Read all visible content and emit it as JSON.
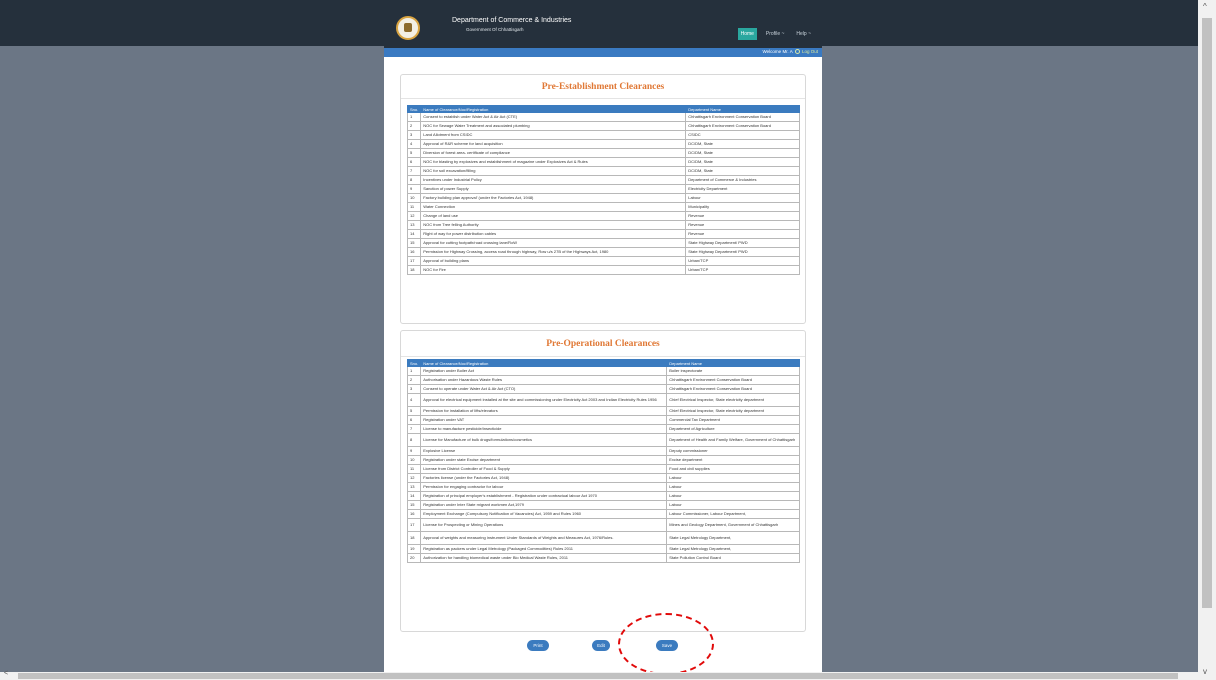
{
  "header": {
    "department": "Department of Commerce & Industries",
    "government": "Government Of Chhattisgarh",
    "nav": [
      {
        "label": "Home"
      },
      {
        "label": "Profile ~"
      },
      {
        "label": "Help ~"
      }
    ],
    "welcome": "Welcome Mr. A",
    "logout": "Log Out"
  },
  "colors": {
    "accent": "#e07835",
    "table_header": "#3b7bbf",
    "nav_active": "#2aa79f",
    "header_bg": "#25303c",
    "annotation": "#e10a0a"
  },
  "pre_establishment": {
    "title": "Pre-Establishment Clearances",
    "columns": [
      "Sno.",
      "Name of Clearance/Noc/Registration",
      "Department Name"
    ],
    "rows": [
      [
        "1",
        "Consent to establish under Water Act & Air Act (CTE)",
        "Chhattisgarh Environment Conservation Board"
      ],
      [
        "2",
        "NOC for Sewage Water Treatment and associated plumbing",
        "Chhattisgarh Environment Conservation Board"
      ],
      [
        "3",
        "Land Allotment from CSIDC",
        "CSIDC"
      ],
      [
        "4",
        "Approval of R&R scheme for land acquisition",
        "DC/DM, State"
      ],
      [
        "5",
        "Diversion of forest area- certificate of compliance",
        "DC/DM, State"
      ],
      [
        "6",
        "NOC for blasting by explosives and establishment of magazine under Explosives Act & Rules",
        "DC/DM, State"
      ],
      [
        "7",
        "NOC for soil excavation/filling",
        "DC/DM, State"
      ],
      [
        "8",
        "Incentives under Industrial Policy",
        "Department of Commerce & Industries"
      ],
      [
        "9",
        "Sanction of power Supply",
        "Electricity Department"
      ],
      [
        "10",
        "Factory building plan approval' (under the Factories Act, 1948)",
        "Labour"
      ],
      [
        "11",
        "Water Connection",
        "Municipality"
      ],
      [
        "12",
        "Change of land use",
        "Revenue"
      ],
      [
        "13",
        "NOC from Tree felling Authority",
        "Revenue"
      ],
      [
        "14",
        "Right of way for power distribution cables",
        "Revenue"
      ],
      [
        "15",
        "Approval for cutting footpath/road crossing lane/RoW",
        "State Highway Department/ PWD"
      ],
      [
        "16",
        "Permission for Highway Crossing, access road through highway, Row u/s 27B of the Highways Act, 1980",
        "State Highway Department/ PWD"
      ],
      [
        "17",
        "Approval of building plans",
        "Urban/TCP"
      ],
      [
        "18",
        "NOC for Fire",
        "Urban/TCP"
      ]
    ]
  },
  "pre_operational": {
    "title": "Pre-Operational Clearances",
    "columns": [
      "Sno.",
      "Name of Clearance/Noc/Registration",
      "Department Name"
    ],
    "rows": [
      [
        "1",
        "Registration under Boiler Act",
        "Boiler inspectorate"
      ],
      [
        "2",
        "Authorisation under Hazardous Waste Rules",
        "Chhattisgarh Environment Conservation Board"
      ],
      [
        "3",
        "Consent to operate under Water Act & Air Act (CTO)",
        "Chhattisgarh Environment Conservation Board"
      ],
      [
        "4",
        "Approval for electrical equipment installed at the site and commissioning under Electricity Act 2003 and Indian Electricity Rules 1956",
        "Chief Electrical Inspector, State electricity department"
      ],
      [
        "5",
        "Permission for installation of lifts/elevators",
        "Chief Electrical Inspector, State electricity department"
      ],
      [
        "6",
        "Registration under VAT",
        "Commercial Tax Department"
      ],
      [
        "7",
        "License to manufacture pesticide/insecticide",
        "Department of Agriculture"
      ],
      [
        "8",
        "License for Manufacture of bulk drugs/formulations/cosmetics",
        "Department of Health and Family Welfare, Government of Chhattisgarh"
      ],
      [
        "9",
        "Explosive License",
        "Deputy commissioner"
      ],
      [
        "10",
        "Registration under state Excise department",
        "Excise department"
      ],
      [
        "11",
        "License from District Controller of Food & Supply",
        "Food and civil supplies"
      ],
      [
        "12",
        "Factories license (under the Factories Act, 1948)",
        "Labour"
      ],
      [
        "13",
        "Permission for engaging contractor for labour",
        "Labour"
      ],
      [
        "14",
        "Registration of principal employer's establishment - Registration under contractual labour Act 1970",
        "Labour"
      ],
      [
        "15",
        "Registration under Inter State migrant workmen Act,1979",
        "Labour"
      ],
      [
        "16",
        "Employment Exchange (Compulsory Notification of Vacancies) Act, 1959 and Rules 1960",
        "Labour Commissioner, Labour Department,"
      ],
      [
        "17",
        "License for Prospecting or Mining Operations",
        "Mines and Geology Department, Government of Chhattisgarh"
      ],
      [
        "18",
        "Approval of weights and measuring instrument Under Standards of Weights and Measures Act, 1976/Rules.",
        "State Legal Metrology Department,"
      ],
      [
        "19",
        "Registration as packers under Legal Metrology (Packaged Commodities) Rules 2011",
        "State Legal Metrology Department,"
      ],
      [
        "20",
        "Authorization for handling biomedical waste under Bio Medical Waste Rules, 2011",
        "State Pollution Control Board"
      ]
    ]
  },
  "actions": {
    "print": "Print",
    "edit": "Edit",
    "save": "Save"
  }
}
